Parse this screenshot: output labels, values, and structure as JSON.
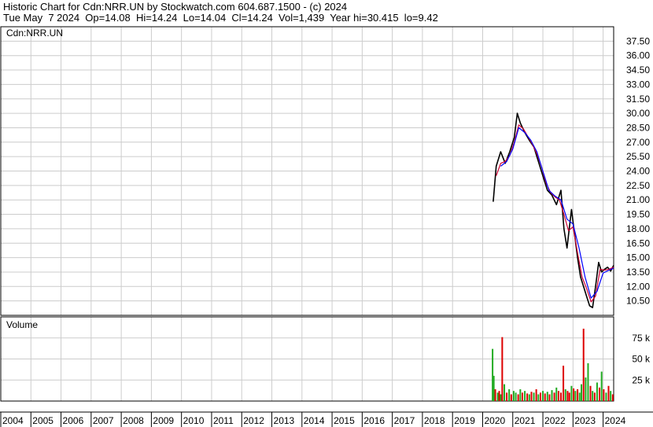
{
  "header": {
    "line1": "Historic Chart for Cdn:NRR.UN by Stockwatch.com 604.687.1500 - (c) 2024",
    "line2": "Tue May  7 2024  Op=14.08  Hi=14.24  Lo=14.04  Cl=14.24  Vol=1,439  Year hi=30.415  lo=9.42"
  },
  "colors": {
    "price": "#000000",
    "ma_short": "#cc0033",
    "ma_long": "#0000ff",
    "vol_up": "#22aa22",
    "vol_down": "#dd0000",
    "grid": "#cccccc"
  },
  "chart_data": [
    {
      "type": "line",
      "title": "Cdn:NRR.UN",
      "ylim": [
        9.0,
        39.0
      ],
      "yticks": [
        "37.50",
        "36.00",
        "34.50",
        "33.00",
        "31.50",
        "30.00",
        "28.50",
        "27.00",
        "25.50",
        "24.00",
        "22.50",
        "21.00",
        "19.50",
        "18.00",
        "16.50",
        "15.00",
        "13.50",
        "12.00",
        "10.50"
      ],
      "series": [
        {
          "key": "price",
          "x": [
            2020.35,
            2020.45,
            2020.6,
            2020.75,
            2020.9,
            2021.05,
            2021.15,
            2021.25,
            2021.4,
            2021.55,
            2021.7,
            2021.85,
            2022.0,
            2022.15,
            2022.3,
            2022.45,
            2022.6,
            2022.7,
            2022.8,
            2022.95,
            2023.05,
            2023.15,
            2023.25,
            2023.35,
            2023.45,
            2023.55,
            2023.65,
            2023.75,
            2023.85,
            2023.95,
            2024.05,
            2024.15,
            2024.25,
            2024.35
          ],
          "values": [
            20.8,
            24.5,
            26.0,
            24.8,
            26.0,
            27.5,
            30.0,
            29.0,
            28.0,
            27.2,
            26.5,
            25.0,
            23.5,
            22.0,
            21.5,
            20.5,
            22.0,
            18.0,
            16.0,
            20.0,
            17.5,
            15.0,
            13.0,
            12.0,
            11.0,
            10.0,
            9.8,
            12.0,
            14.5,
            13.5,
            13.8,
            14.0,
            13.6,
            14.2
          ]
        },
        {
          "key": "ma_short",
          "x": [
            2020.45,
            2020.6,
            2020.75,
            2020.9,
            2021.05,
            2021.2,
            2021.35,
            2021.5,
            2021.65,
            2021.8,
            2021.95,
            2022.1,
            2022.25,
            2022.4,
            2022.55,
            2022.7,
            2022.85,
            2023.0,
            2023.15,
            2023.3,
            2023.45,
            2023.6,
            2023.75,
            2023.9,
            2024.05,
            2024.2,
            2024.35
          ],
          "values": [
            23.5,
            24.8,
            25.0,
            25.6,
            27.0,
            28.8,
            28.4,
            27.6,
            26.8,
            25.8,
            24.5,
            22.8,
            21.8,
            21.3,
            21.0,
            19.5,
            17.8,
            18.2,
            15.5,
            13.0,
            11.8,
            10.4,
            11.0,
            13.8,
            13.7,
            13.8,
            14.0
          ]
        },
        {
          "key": "ma_long",
          "x": [
            2020.6,
            2020.8,
            2021.0,
            2021.2,
            2021.4,
            2021.6,
            2021.8,
            2022.0,
            2022.2,
            2022.4,
            2022.6,
            2022.8,
            2023.0,
            2023.2,
            2023.4,
            2023.6,
            2023.8,
            2024.0,
            2024.2,
            2024.35
          ],
          "values": [
            24.5,
            25.0,
            26.3,
            28.5,
            28.0,
            27.2,
            26.0,
            24.0,
            22.0,
            21.4,
            21.0,
            19.0,
            18.5,
            16.0,
            13.0,
            10.8,
            11.5,
            13.4,
            13.7,
            13.9
          ]
        }
      ]
    },
    {
      "type": "bar",
      "title": "Volume",
      "ylim": [
        0,
        100
      ],
      "yticks": [
        "75 k",
        "50 k",
        "25 k"
      ],
      "x": [
        2020.33,
        2020.37,
        2020.42,
        2020.5,
        2020.55,
        2020.6,
        2020.65,
        2020.72,
        2020.8,
        2020.88,
        2020.95,
        2021.03,
        2021.1,
        2021.18,
        2021.25,
        2021.32,
        2021.4,
        2021.48,
        2021.55,
        2021.62,
        2021.7,
        2021.78,
        2021.85,
        2021.92,
        2022.0,
        2022.07,
        2022.15,
        2022.22,
        2022.3,
        2022.38,
        2022.45,
        2022.52,
        2022.6,
        2022.68,
        2022.75,
        2022.82,
        2022.88,
        2022.95,
        2023.02,
        2023.08,
        2023.15,
        2023.22,
        2023.28,
        2023.35,
        2023.42,
        2023.5,
        2023.58,
        2023.65,
        2023.72,
        2023.8,
        2023.88,
        2023.95,
        2024.02,
        2024.1,
        2024.18,
        2024.25,
        2024.32
      ],
      "values": [
        62,
        30,
        14,
        10,
        12,
        8,
        76,
        20,
        10,
        14,
        8,
        12,
        10,
        8,
        14,
        10,
        12,
        9,
        8,
        11,
        10,
        14,
        8,
        10,
        12,
        9,
        11,
        8,
        13,
        10,
        16,
        12,
        10,
        42,
        14,
        12,
        10,
        18,
        15,
        12,
        14,
        10,
        20,
        86,
        28,
        45,
        18,
        12,
        10,
        22,
        16,
        35,
        14,
        10,
        18,
        12,
        8
      ],
      "colors": [
        "up",
        "up",
        "down",
        "up",
        "down",
        "up",
        "down",
        "up",
        "down",
        "up",
        "down",
        "up",
        "up",
        "down",
        "up",
        "down",
        "up",
        "down",
        "up",
        "down",
        "up",
        "down",
        "up",
        "down",
        "up",
        "down",
        "up",
        "down",
        "up",
        "down",
        "up",
        "down",
        "down",
        "down",
        "up",
        "down",
        "down",
        "up",
        "down",
        "up",
        "down",
        "up",
        "up",
        "down",
        "up",
        "up",
        "down",
        "up",
        "down",
        "up",
        "down",
        "up",
        "down",
        "up",
        "down",
        "up",
        "down"
      ]
    }
  ],
  "x_axis": {
    "labels": [
      "2004",
      "2005",
      "2006",
      "2007",
      "2008",
      "2009",
      "2010",
      "2011",
      "2012",
      "2013",
      "2014",
      "2015",
      "2016",
      "2017",
      "2018",
      "2019",
      "2020",
      "2021",
      "2022",
      "2023",
      "2024"
    ]
  }
}
